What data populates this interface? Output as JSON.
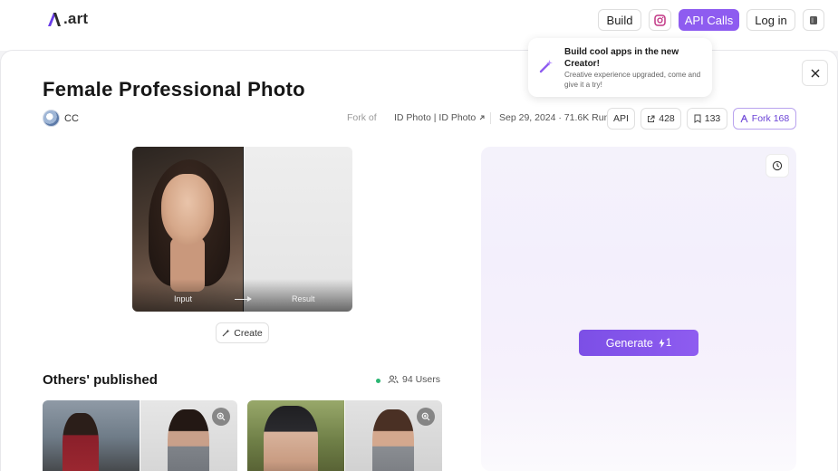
{
  "header": {
    "logo": ".art",
    "build_label": "Build",
    "api_calls_label": "API Calls",
    "login_label": "Log in"
  },
  "tooltip": {
    "title": "Build cool apps in the new Creator!",
    "subtitle": "Creative experience upgraded, come and give it a try!"
  },
  "app": {
    "title": "Female Professional Photo",
    "author": "CC",
    "fork_of_label": "Fork of",
    "fork_source": "ID Photo | ID Photo",
    "date_runs": "Sep 29, 2024 · 71.6K Run",
    "api_label": "API",
    "share_count": "428",
    "bookmark_count": "133",
    "fork_label": "Fork 168"
  },
  "compare": {
    "input_label": "Input",
    "result_label": "Result"
  },
  "create_label": "Create",
  "others": {
    "title": "Others' published",
    "users": "94 Users"
  },
  "generate": {
    "label": "Generate",
    "cost": "1"
  },
  "colors": {
    "accent": "#8e5cf0",
    "online": "#2bb673"
  },
  "icons": {
    "instagram": "instagram-icon",
    "app": "app-icon",
    "close": "close-icon",
    "history": "history-icon",
    "zoom": "zoom-icon",
    "users": "users-icon",
    "share": "share-icon",
    "bookmark": "bookmark-icon",
    "fork": "fork-icon",
    "magic": "magic-wand-icon",
    "bolt": "bolt-icon"
  }
}
